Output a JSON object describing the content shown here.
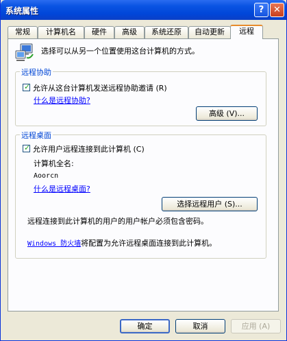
{
  "window": {
    "title": "系统属性",
    "help_label": "?",
    "close_label": "✕"
  },
  "tabs": [
    "常规",
    "计算机名",
    "硬件",
    "高级",
    "系统还原",
    "自动更新",
    "远程"
  ],
  "intro": {
    "text": "选择可以从另一个位置使用这台计算机的方式。",
    "icon": "remote-computer-icon"
  },
  "remote_assistance": {
    "title": "远程协助",
    "checkbox_label": "允许从这台计算机发送远程协助邀请",
    "checkbox_mnemonic": "(R)",
    "checked": true,
    "help_link": "什么是远程协助?",
    "advanced_button": "高级 (V)..."
  },
  "remote_desktop": {
    "title": "远程桌面",
    "checkbox_label": "允许用户远程连接到此计算机",
    "checkbox_mnemonic": "(C)",
    "checked": true,
    "computer_name_label": "计算机全名:",
    "computer_name_value": "Aoorcn",
    "help_link": "什么是远程桌面?",
    "select_users_button": "选择远程用户 (S)...",
    "password_note": "远程连接到此计算机的用户的用户帐户必须包含密码。",
    "firewall_link": "Windows 防火墙",
    "firewall_text": "将配置为允许远程桌面连接到此计算机。"
  },
  "footer": {
    "ok": "确定",
    "cancel": "取消",
    "apply": "应用 (A)"
  },
  "colors": {
    "titlebar": "#0a54e3",
    "group_title": "#0046d5",
    "link": "#0000ff",
    "active_tab_accent": "#e68b2c"
  }
}
